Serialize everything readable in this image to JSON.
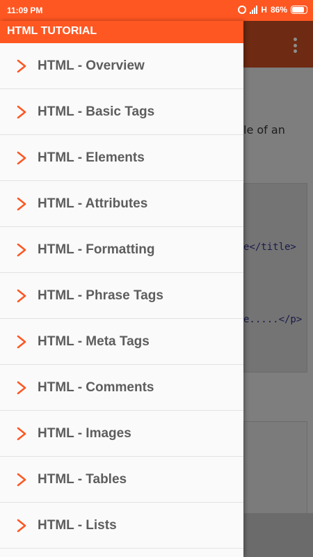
{
  "status_bar": {
    "time": "11:09 PM",
    "network": "H",
    "battery": "86%",
    "battery_level": 0.86
  },
  "drawer": {
    "title": "HTML TUTORIAL",
    "items": [
      {
        "label": "HTML - Overview"
      },
      {
        "label": "HTML - Basic Tags"
      },
      {
        "label": "HTML - Elements"
      },
      {
        "label": "HTML - Attributes"
      },
      {
        "label": "HTML - Formatting"
      },
      {
        "label": "HTML - Phrase Tags"
      },
      {
        "label": "HTML - Meta Tags"
      },
      {
        "label": "HTML - Comments"
      },
      {
        "label": "HTML - Images"
      },
      {
        "label": "HTML - Tables"
      },
      {
        "label": "HTML - Lists"
      }
    ],
    "item_icon": "chevron-right-icon"
  },
  "background": {
    "text_fragment": "le of an",
    "code_line_1": "e</title>",
    "code_line_2": "e.....</p>",
    "overflow_icon": "more-vert-icon"
  },
  "colors": {
    "accent": "#ff5722",
    "chevron": "#ff5722",
    "drawer_bg": "#fafafa",
    "item_text": "#5d5d5d"
  }
}
